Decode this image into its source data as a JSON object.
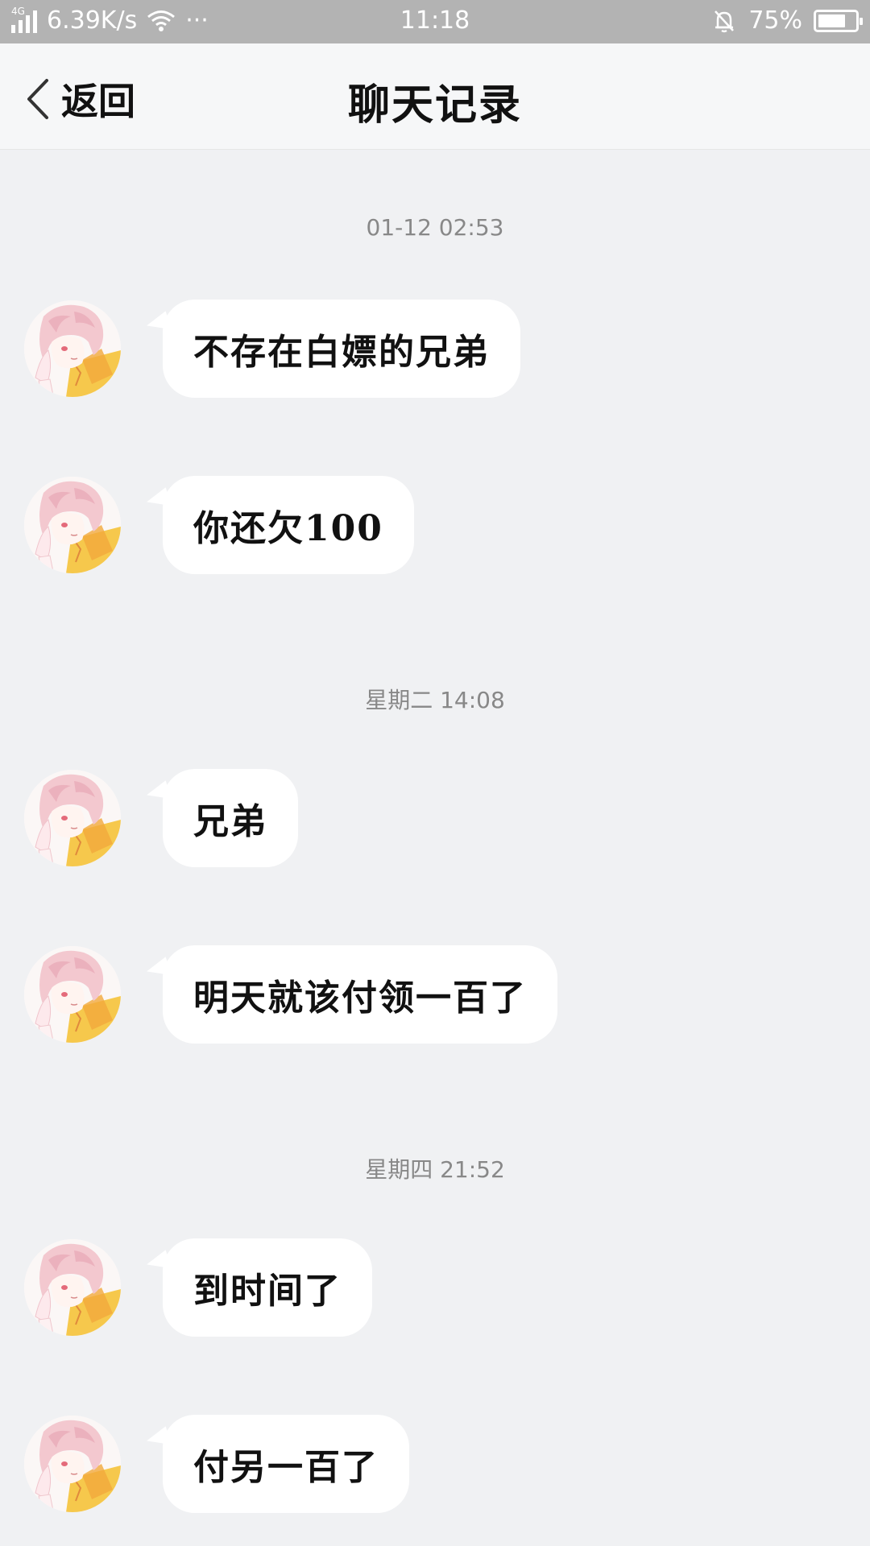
{
  "status_bar": {
    "network_type": "4G",
    "speed": "6.39K/s",
    "more": "···",
    "time": "11:18",
    "battery": "75%",
    "battery_level": 0.75
  },
  "nav": {
    "back_label": "返回",
    "title": "聊天记录"
  },
  "timestamps": [
    "01-12 02:53",
    "星期二 14:08",
    "星期四 21:52"
  ],
  "messages": [
    {
      "text": "不存在白嫖的兄弟"
    },
    {
      "text": "你还欠100"
    },
    {
      "text": "兄弟"
    },
    {
      "text": "明天就该付领一百了"
    },
    {
      "text": "到时间了"
    },
    {
      "text": "付另一百了"
    }
  ],
  "colors": {
    "background": "#f0f1f3",
    "status_bar": "#b3b3b3",
    "nav_bar": "#f6f7f8",
    "bubble": "#ffffff",
    "timestamp_text": "#888888"
  }
}
